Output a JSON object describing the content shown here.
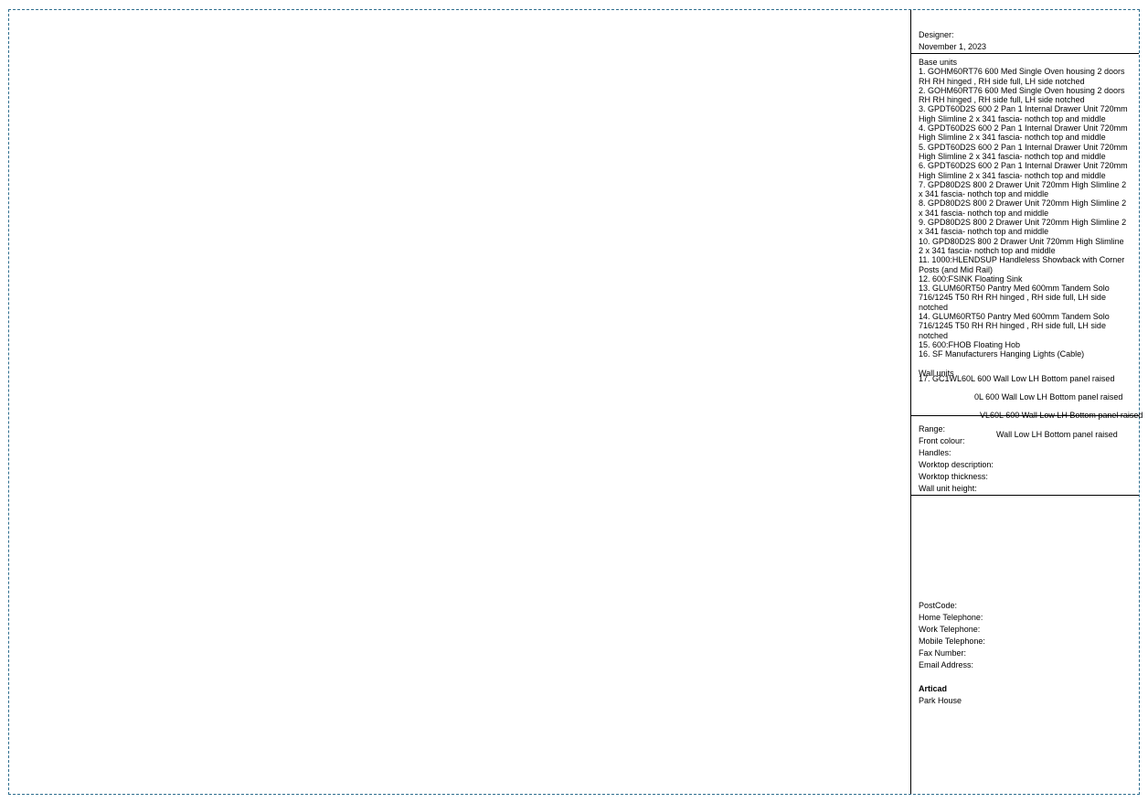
{
  "header": {
    "designer_label": "Designer:",
    "date": "November 1, 2023"
  },
  "units": {
    "base_title": "Base units",
    "base_items": [
      "1. GOHM60RT76 600 Med Single Oven housing 2 doors RH RH hinged , RH side full, LH side notched",
      "2. GOHM60RT76 600 Med Single Oven housing 2 doors RH RH hinged , RH side full, LH side notched",
      "3. GPDT60D2S 600 2 Pan 1 Internal Drawer Unit 720mm High  Slimline 2 x 341 fascia- nothch top and middle",
      "4. GPDT60D2S 600 2 Pan 1 Internal Drawer Unit 720mm High  Slimline 2 x 341 fascia- nothch top and middle",
      "5. GPDT60D2S 600 2 Pan 1 Internal Drawer Unit 720mm High  Slimline 2 x 341 fascia- nothch top and middle",
      "6. GPDT60D2S 600 2 Pan 1 Internal Drawer Unit 720mm High  Slimline 2 x 341 fascia- nothch top and middle",
      "7. GPD80D2S 800 2 Drawer Unit 720mm High Slimline 2 x 341 fascia- nothch top and middle",
      "8. GPD80D2S 800 2 Drawer Unit 720mm High Slimline 2 x 341 fascia- nothch top and middle",
      "9. GPD80D2S 800 2 Drawer Unit 720mm High Slimline 2 x 341 fascia- nothch top and middle",
      "10. GPD80D2S 800 2 Drawer Unit 720mm High Slimline 2 x 341 fascia- nothch top and middle",
      "11. 1000:HLENDSUP Handleless Showback with Corner Posts (and Mid Rail)",
      "12. 600:FSINK Floating Sink",
      "13. GLUM60RT50 Pantry Med 600mm Tandem Solo 716/1245 T50 RH RH hinged , RH side full, LH side notched",
      "14. GLUM60RT50 Pantry Med 600mm Tandem Solo 716/1245 T50 RH RH hinged , RH side full, LH side notched",
      "15. 600:FHOB Floating Hob",
      "16. SF Manufacturers Hanging Lights (Cable)"
    ],
    "wall_title": "Wall units",
    "wall_overflow": [
      "17. GC1WL60L 600 Wall Low LH Bottom panel raised",
      "0L 600 Wall Low LH Bottom panel raised",
      "VL60L 600 Wall Low LH Bottom panel raised",
      "Wall Low LH Bottom panel raised"
    ]
  },
  "specs": {
    "range": "Range:",
    "front_colour": "Front colour:",
    "handles": "Handles:",
    "worktop_description": "Worktop description:",
    "worktop_thickness": "Worktop thickness:",
    "wall_unit_height": "Wall unit height:"
  },
  "contact": {
    "postcode": "PostCode:",
    "home_tel": "Home Telephone:",
    "work_tel": "Work Telephone:",
    "mobile_tel": "Mobile Telephone:",
    "fax": "Fax Number:",
    "email": "Email Address:",
    "company": "Articad",
    "address": "Park House"
  }
}
